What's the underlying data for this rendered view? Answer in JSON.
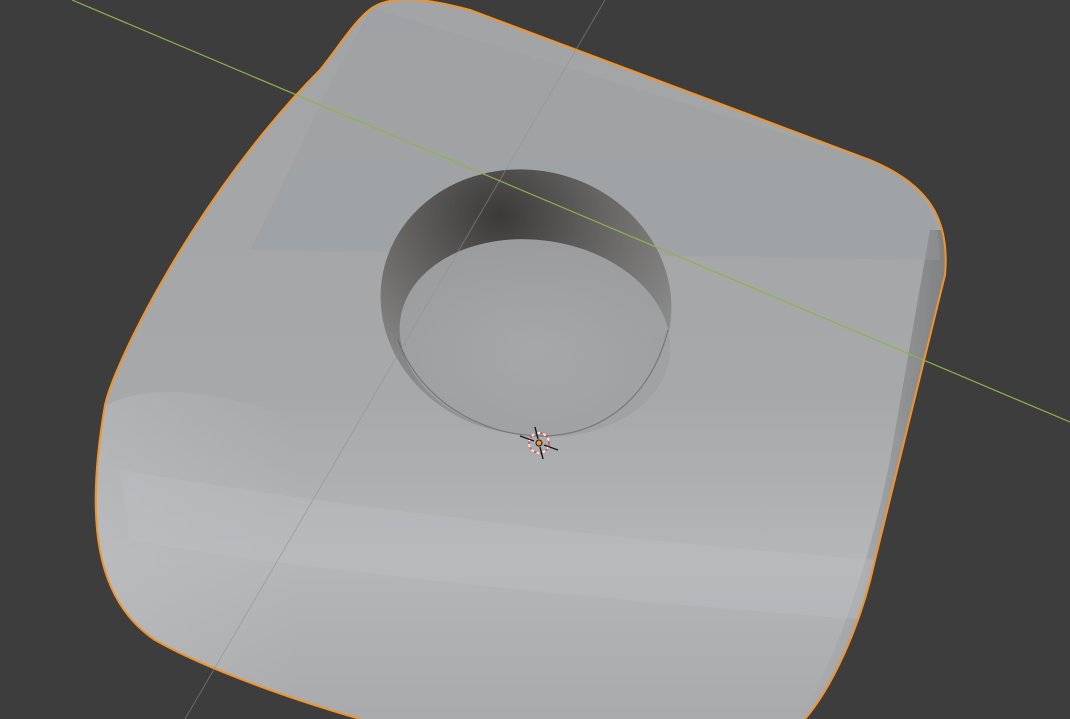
{
  "viewport": {
    "background": "#3d3d3d",
    "mode": "Object Mode",
    "shading": "solid"
  },
  "object": {
    "kind": "rounded cube with cylindrical hole",
    "selected": true,
    "active": true,
    "outline_color": "#f0932b",
    "surface_color": "#a9abad"
  },
  "axes": {
    "x_axis_color": "#8fb34a",
    "visible": [
      "x"
    ]
  },
  "cursor_3d": {
    "visible": true,
    "ring_color": "#e0524a"
  },
  "origin": {
    "visible": true,
    "color": "#f0932b"
  }
}
